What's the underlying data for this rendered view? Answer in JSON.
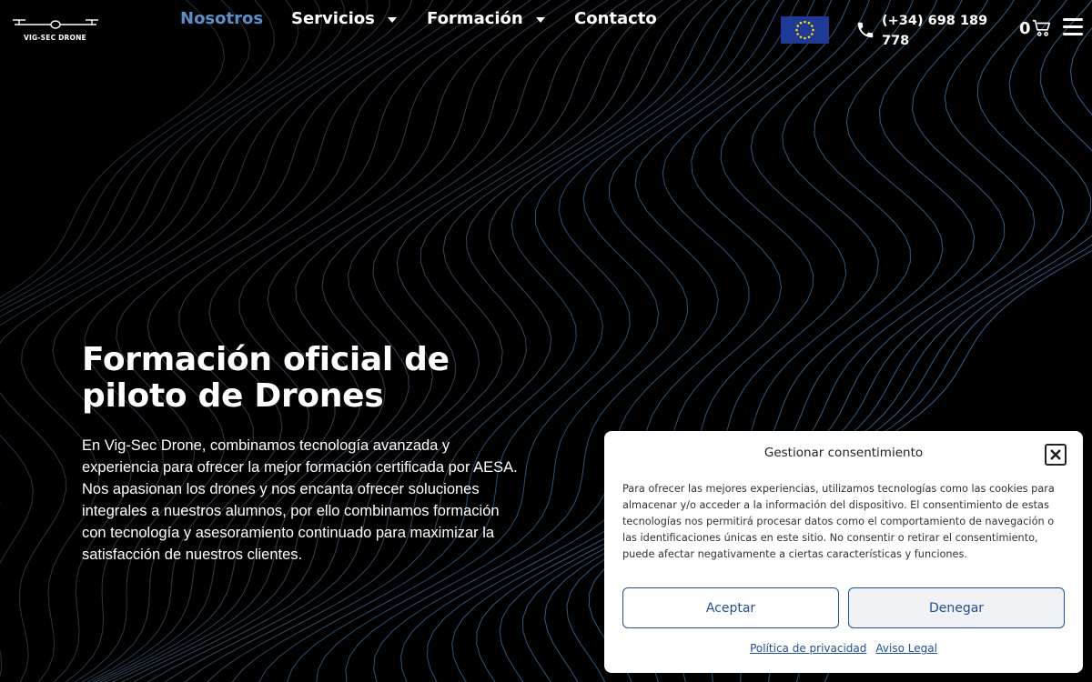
{
  "header": {
    "logo_text": "VIG-SEC DRONE",
    "nav": [
      {
        "label": "Nosotros",
        "active": true
      },
      {
        "label": "Servicios",
        "dropdown": true
      },
      {
        "label": "Formación",
        "dropdown": true
      },
      {
        "label": "Contacto"
      }
    ],
    "language_flag": "eu-flag-icon",
    "phone": "(+34) 698 189 778",
    "cart_count": "0",
    "menu_icon": "hamburger-icon"
  },
  "hero": {
    "title": "Formación oficial de piloto de Drones",
    "description": "En Vig-Sec Drone, combinamos tecnología avanzada y experiencia para ofrecer la mejor formación certificada por AESA. Nos apasionan los drones y nos encanta ofrecer soluciones integrales a nuestros alumnos, por ello combinamos formación con tecnología y asesoramiento continuado para maximizar la satisfacción de nuestros clientes."
  },
  "consent": {
    "title": "Gestionar consentimiento",
    "body": "Para ofrecer las mejores experiencias, utilizamos tecnologías como las cookies para almacenar y/o acceder a la información del dispositivo. El consentimiento de estas tecnologías nos permitirá procesar datos como el comportamiento de navegación o las identificaciones únicas en este sitio. No consentir o retirar el consentimiento, puede afectar negativamente a ciertas características y funciones.",
    "accept_label": "Aceptar",
    "deny_label": "Denegar",
    "privacy_link": "Política de privacidad",
    "legal_link": "Aviso Legal"
  },
  "colors": {
    "background": "#000000",
    "accent_nav": "#5b8fc9",
    "button_text": "#1e4f9a",
    "flag_blue": "#1e3a96",
    "flag_star": "#ffdd00"
  }
}
